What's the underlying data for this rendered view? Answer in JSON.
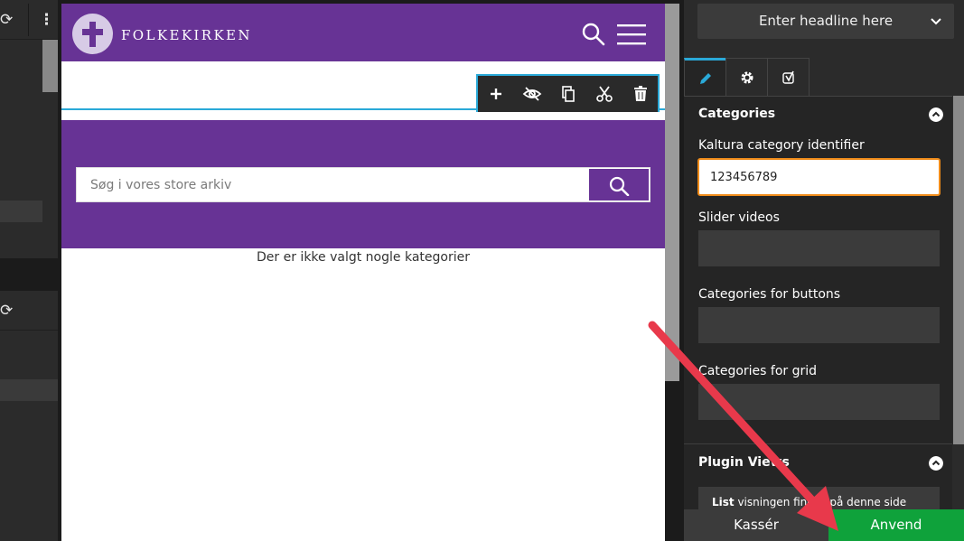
{
  "site": {
    "name": "FOLKEKIRKEN",
    "search_placeholder": "Søg i vores store arkiv",
    "no_categories_text": "Der er ikke valgt nogle kategorier"
  },
  "right_panel": {
    "headline_placeholder": "Enter headline here",
    "tabs": [
      {
        "name": "edit",
        "icon": "pencil-icon"
      },
      {
        "name": "settings",
        "icon": "gear-icon"
      },
      {
        "name": "seo",
        "icon": "yoast-icon"
      }
    ],
    "categories_section": {
      "title": "Categories",
      "kaltura_label": "Kaltura category identifier",
      "kaltura_value": "123456789",
      "slider_label": "Slider videos",
      "buttons_label": "Categories for buttons",
      "grid_label": "Categories for grid"
    },
    "plugin_views": {
      "title": "Plugin Views",
      "list_bold": "List",
      "list_text": " visningen findes på denne side"
    },
    "discard_label": "Kassér",
    "apply_label": "Anvend"
  },
  "colors": {
    "brand_purple": "#673395",
    "accent_blue": "#2aa9d8",
    "focus_orange": "#f08c1a",
    "apply_green": "#0fa23b",
    "arrow_red": "#e8394b"
  }
}
